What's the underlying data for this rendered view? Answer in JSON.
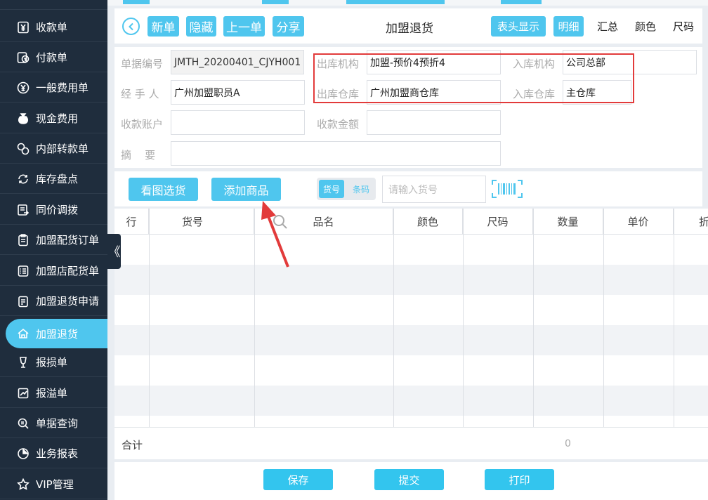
{
  "sidebar": {
    "items": [
      {
        "label": "收款单",
        "icon": "yen-receipt-icon"
      },
      {
        "label": "付款单",
        "icon": "payment-icon"
      },
      {
        "label": "一般费用单",
        "icon": "yen-circle-icon"
      },
      {
        "label": "现金费用",
        "icon": "money-bag-icon"
      },
      {
        "label": "内部转款单",
        "icon": "transfer-icon"
      },
      {
        "label": "库存盘点",
        "icon": "inventory-icon"
      },
      {
        "label": "同价调拨",
        "icon": "allocate-icon"
      },
      {
        "label": "加盟配货订单",
        "icon": "clipboard-icon"
      },
      {
        "label": "加盟店配货单",
        "icon": "list-icon"
      },
      {
        "label": "加盟退货申请",
        "icon": "return-request-icon"
      },
      {
        "label": "加盟退货",
        "icon": "home-icon",
        "active": true
      },
      {
        "label": "报损单",
        "icon": "wine-glass-icon"
      },
      {
        "label": "报溢单",
        "icon": "overflow-icon"
      },
      {
        "label": "单据查询",
        "icon": "search-doc-icon"
      },
      {
        "label": "业务报表",
        "icon": "pie-chart-icon"
      },
      {
        "label": "VIP管理",
        "icon": "star-icon"
      }
    ],
    "collapse_glyph": "《"
  },
  "toolbar": {
    "new_label": "新单",
    "hide_label": "隐藏",
    "prev_label": "上一单",
    "share_label": "分享",
    "title": "加盟退货",
    "header_show_label": "表头显示",
    "detail_label": "明细",
    "summary_label": "汇总",
    "color_label": "颜色",
    "size_label": "尺码"
  },
  "form": {
    "doc_no_label": "单据编号",
    "doc_no_value": "JMTH_20200401_CJYH001",
    "out_org_label": "出库机构",
    "out_org_value": "加盟-预价4预折4",
    "in_org_label": "入库机构",
    "in_org_value": "公司总部",
    "handler_label": "经 手 人",
    "handler_value": "广州加盟职员A",
    "out_wh_label": "出库仓库",
    "out_wh_value": "广州加盟商仓库",
    "in_wh_label": "入库仓库",
    "in_wh_value": "主仓库",
    "account_label": "收款账户",
    "account_value": "",
    "amount_label": "收款金额",
    "amount_value": "",
    "memo_label": "摘    要",
    "memo_value": ""
  },
  "actions": {
    "pick_by_image_label": "看图选货",
    "add_product_label": "添加商品",
    "toggle_on": "货号",
    "toggle_off": "条码",
    "code_placeholder": "请输入货号"
  },
  "table": {
    "columns": [
      "行",
      "货号",
      "品名",
      "颜色",
      "尺码",
      "数量",
      "单价",
      "折"
    ],
    "rows": [],
    "total_label": "合计",
    "total_quantity": "0"
  },
  "footer": {
    "save_label": "保存",
    "submit_label": "提交",
    "print_label": "打印"
  },
  "colors": {
    "accent": "#4fc6ee",
    "sidebar_bg": "#1f2d3d",
    "highlight_box": "#e23b3b"
  }
}
